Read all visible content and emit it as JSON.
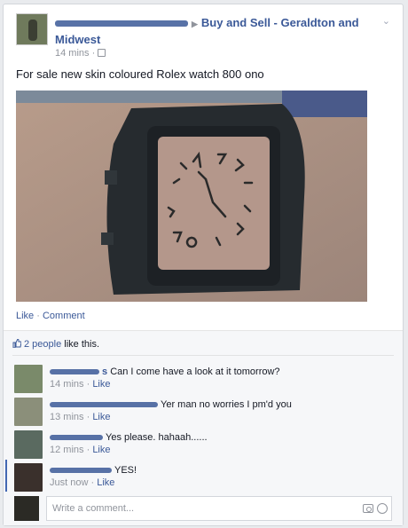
{
  "post": {
    "group_name": "Buy and Sell - Geraldton and",
    "group_name_2": "Midwest",
    "time": "14 mins ·",
    "text": "For sale new skin coloured Rolex watch 800 ono",
    "like_label": "Like",
    "separator": "·",
    "comment_label": "Comment"
  },
  "likes": {
    "count_text": "2 people",
    "suffix": "like this."
  },
  "comments": [
    {
      "name_tail": "s",
      "text": "Can I come have a look at it tomorrow?",
      "time": "14 mins ·",
      "like": "Like"
    },
    {
      "name_tail": "",
      "text": "Yer man no worries I pm'd you",
      "time": "13 mins ·",
      "like": "Like"
    },
    {
      "name_tail": "",
      "text": "Yes please. hahaah......",
      "time": "12 mins ·",
      "like": "Like"
    },
    {
      "name_tail": "",
      "text": "YES!",
      "time": "Just now ·",
      "like": "Like"
    }
  ],
  "write": {
    "placeholder": "Write a comment..."
  },
  "icons": {
    "chevron": "chevron-down-icon",
    "globe": "audience-icon",
    "thumb": "thumbs-up-icon",
    "camera": "camera-icon",
    "emoji": "emoji-icon"
  },
  "colors": {
    "link": "#3b5998",
    "muted": "#90949c",
    "ufi_bg": "#f6f7f9"
  }
}
